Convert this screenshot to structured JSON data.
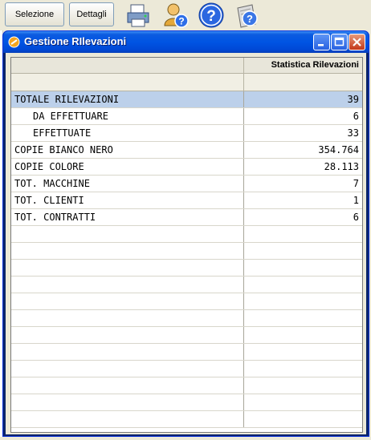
{
  "toolbar": {
    "selezione_label": "Selezione",
    "dettagli_label": "Dettagli",
    "icons": [
      "printer-icon",
      "user-help-icon",
      "help-icon",
      "help-paper-icon"
    ]
  },
  "window": {
    "title": "Gestione RIlevazioni",
    "column_header": "Statistica Rilevazioni",
    "colors": {
      "titlebar": "#0054e3",
      "highlight_row": "#bcd0ea",
      "close_button": "#c3381b"
    }
  },
  "table": {
    "rows": [
      {
        "label": "TOTALE RILEVAZIONI",
        "value": "39",
        "indent": false,
        "highlight": true
      },
      {
        "label": "DA EFFETTUARE",
        "value": "6",
        "indent": true,
        "highlight": false
      },
      {
        "label": "EFFETTUATE",
        "value": "33",
        "indent": true,
        "highlight": false
      },
      {
        "label": "COPIE BIANCO NERO",
        "value": "354.764",
        "indent": false,
        "highlight": false
      },
      {
        "label": "COPIE COLORE",
        "value": "28.113",
        "indent": false,
        "highlight": false
      },
      {
        "label": "TOT. MACCHINE",
        "value": "7",
        "indent": false,
        "highlight": false
      },
      {
        "label": "TOT. CLIENTI",
        "value": "1",
        "indent": false,
        "highlight": false
      },
      {
        "label": "TOT. CONTRATTI",
        "value": "6",
        "indent": false,
        "highlight": false
      }
    ],
    "empty_rows": 12
  }
}
